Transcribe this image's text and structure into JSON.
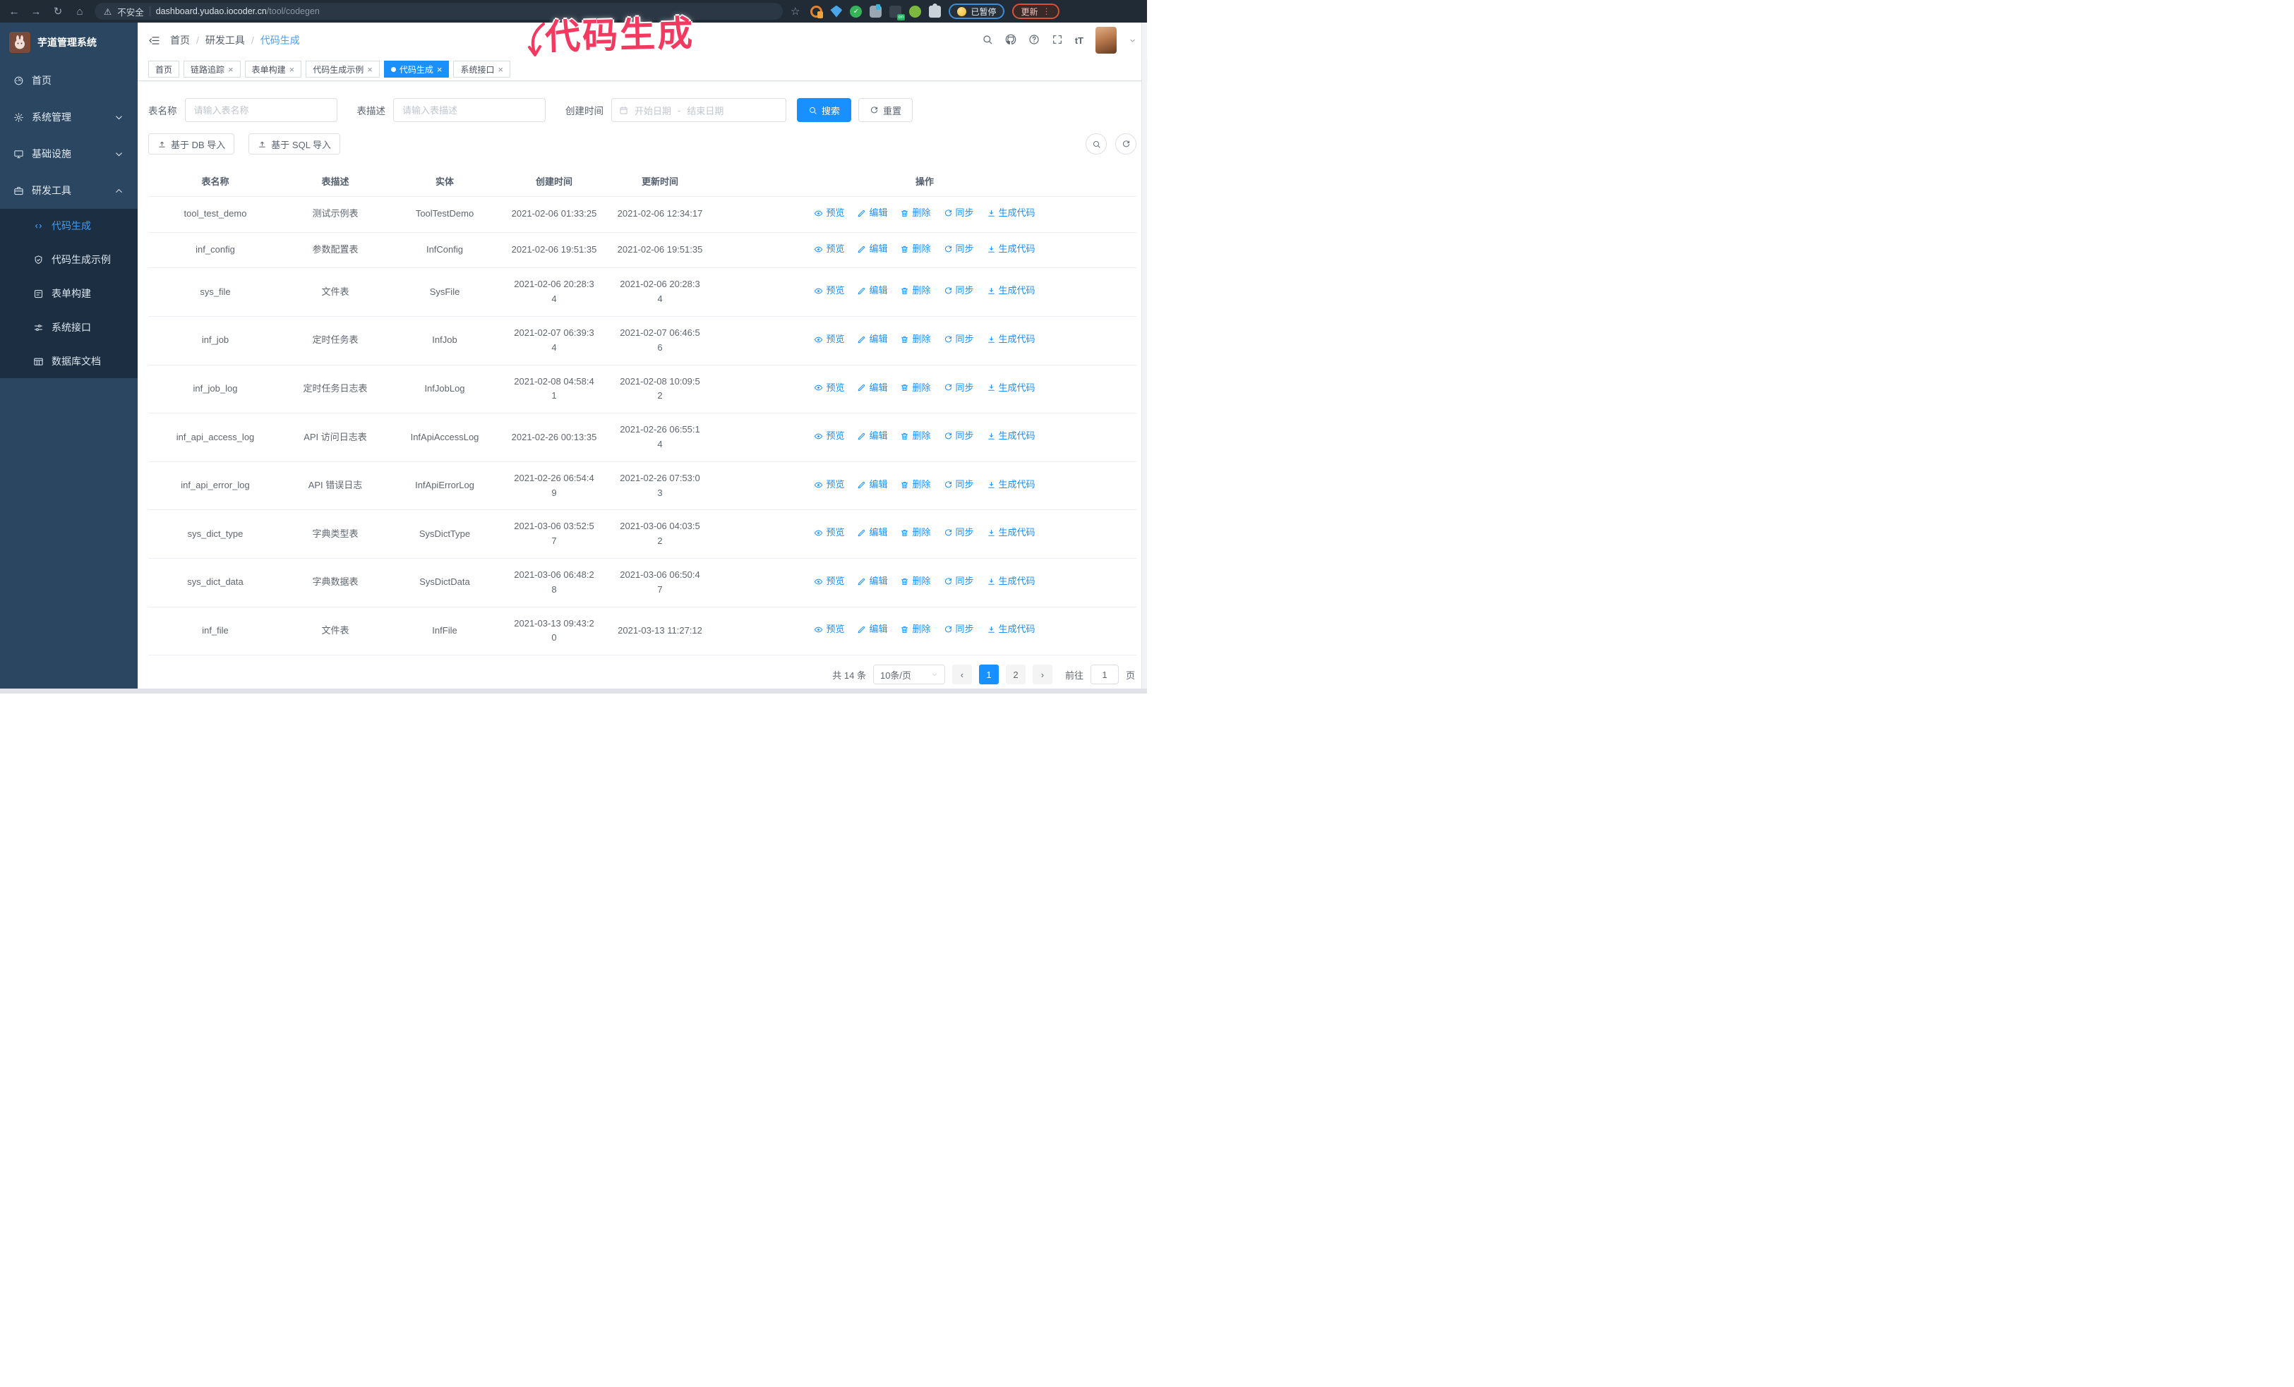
{
  "browser": {
    "secure_label": "不安全",
    "url_host": "dashboard.yudao.iocoder.cn",
    "url_path": "/tool/codegen",
    "ext_on": "on",
    "paused_label": "已暂停",
    "update_label": "更新"
  },
  "annotation": {
    "text": "代码生成"
  },
  "sidebar": {
    "brand": "芋道管理系统",
    "items": [
      {
        "id": "home",
        "label": "首页",
        "icon": "dashboard"
      },
      {
        "id": "system-admin",
        "label": "系统管理",
        "icon": "gear",
        "chevron": "down"
      },
      {
        "id": "infrastructure",
        "label": "基础设施",
        "icon": "monitor",
        "chevron": "down"
      },
      {
        "id": "dev-tools",
        "label": "研发工具",
        "icon": "toolbox",
        "chevron": "up",
        "expanded": true,
        "children": [
          {
            "id": "codegen",
            "label": "代码生成",
            "icon": "code",
            "active": true
          },
          {
            "id": "codegen-example",
            "label": "代码生成示例",
            "icon": "shield-eye"
          },
          {
            "id": "form-builder",
            "label": "表单构建",
            "icon": "form"
          },
          {
            "id": "system-api",
            "label": "系统接口",
            "icon": "sliders"
          },
          {
            "id": "db-doc",
            "label": "数据库文档",
            "icon": "db-table"
          }
        ]
      }
    ]
  },
  "navbar": {
    "breadcrumb": [
      "首页",
      "研发工具",
      "代码生成"
    ]
  },
  "tabs": [
    {
      "id": "home",
      "label": "首页",
      "closable": false
    },
    {
      "id": "trace",
      "label": "链路追踪",
      "closable": true
    },
    {
      "id": "form-builder",
      "label": "表单构建",
      "closable": true
    },
    {
      "id": "codegen-example",
      "label": "代码生成示例",
      "closable": true
    },
    {
      "id": "codegen",
      "label": "代码生成",
      "closable": true,
      "active": true
    },
    {
      "id": "system-api",
      "label": "系统接口",
      "closable": true
    }
  ],
  "filters": {
    "table_name_label": "表名称",
    "table_name_placeholder": "请输入表名称",
    "table_desc_label": "表描述",
    "table_desc_placeholder": "请输入表描述",
    "create_time_label": "创建时间",
    "start_placeholder": "开始日期",
    "range_separator": "-",
    "end_placeholder": "结束日期",
    "search_label": "搜索",
    "reset_label": "重置"
  },
  "toolbar": {
    "import_db_label": "基于 DB 导入",
    "import_sql_label": "基于 SQL 导入"
  },
  "table": {
    "columns": [
      "表名称",
      "表描述",
      "实体",
      "创建时间",
      "更新时间",
      "操作"
    ],
    "rows": [
      {
        "name": "tool_test_demo",
        "description": "测试示例表",
        "entity": "ToolTestDemo",
        "created": "2021-02-06 01:33:25",
        "updated": "2021-02-06 12:34:17"
      },
      {
        "name": "inf_config",
        "description": "参数配置表",
        "entity": "InfConfig",
        "created": "2021-02-06 19:51:35",
        "updated": "2021-02-06 19:51:35"
      },
      {
        "name": "sys_file",
        "description": "文件表",
        "entity": "SysFile",
        "created": "2021-02-06 20:28:3\n4",
        "updated": "2021-02-06 20:28:3\n4"
      },
      {
        "name": "inf_job",
        "description": "定时任务表",
        "entity": "InfJob",
        "created": "2021-02-07 06:39:3\n4",
        "updated": "2021-02-07 06:46:5\n6"
      },
      {
        "name": "inf_job_log",
        "description": "定时任务日志表",
        "entity": "InfJobLog",
        "created": "2021-02-08 04:58:4\n1",
        "updated": "2021-02-08 10:09:5\n2"
      },
      {
        "name": "inf_api_access_log",
        "description": "API 访问日志表",
        "entity": "InfApiAccessLog",
        "created": "2021-02-26 00:13:35",
        "updated": "2021-02-26 06:55:1\n4"
      },
      {
        "name": "inf_api_error_log",
        "description": "API 错误日志",
        "entity": "InfApiErrorLog",
        "created": "2021-02-26 06:54:4\n9",
        "updated": "2021-02-26 07:53:0\n3"
      },
      {
        "name": "sys_dict_type",
        "description": "字典类型表",
        "entity": "SysDictType",
        "created": "2021-03-06 03:52:5\n7",
        "updated": "2021-03-06 04:03:5\n2"
      },
      {
        "name": "sys_dict_data",
        "description": "字典数据表",
        "entity": "SysDictData",
        "created": "2021-03-06 06:48:2\n8",
        "updated": "2021-03-06 06:50:4\n7"
      },
      {
        "name": "inf_file",
        "description": "文件表",
        "entity": "InfFile",
        "created": "2021-03-13 09:43:2\n0",
        "updated": "2021-03-13 11:27:12"
      }
    ],
    "row_actions": [
      {
        "id": "preview",
        "label": "预览",
        "icon": "eye"
      },
      {
        "id": "edit",
        "label": "编辑",
        "icon": "edit"
      },
      {
        "id": "delete",
        "label": "删除",
        "icon": "delete"
      },
      {
        "id": "sync",
        "label": "同步",
        "icon": "sync"
      },
      {
        "id": "generate",
        "label": "生成代码",
        "icon": "download"
      }
    ]
  },
  "pagination": {
    "total_label": "共 14 条",
    "page_size_label": "10条/页",
    "prev": "‹",
    "next": "›",
    "pages": [
      "1",
      "2"
    ],
    "active_page": "1",
    "goto_label": "前往",
    "goto_value": "1",
    "page_unit_label": "页"
  },
  "colors": {
    "accent": "#1890ff",
    "annotation": "#f43960",
    "sidebar_bg": "#2a4660",
    "submenu_bg": "#1c2e41",
    "chrome_bg": "#202b36"
  }
}
